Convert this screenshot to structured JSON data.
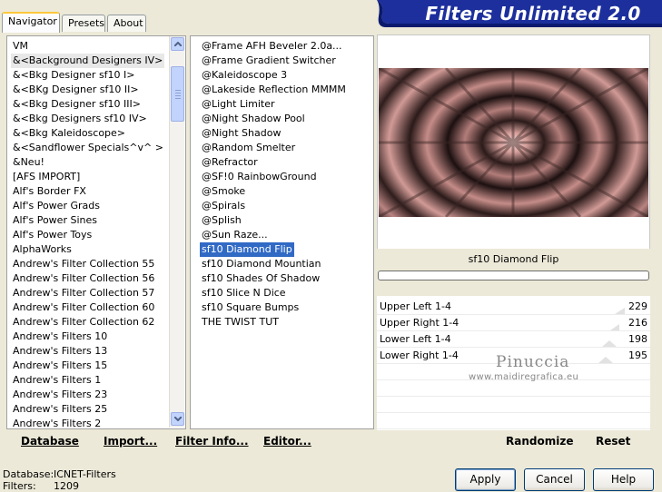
{
  "banner": {
    "title": "Filters Unlimited 2.0"
  },
  "tabs": [
    {
      "label": "Navigator"
    },
    {
      "label": "Presets"
    },
    {
      "label": "About"
    }
  ],
  "categories": [
    "VM",
    "&<Background Designers IV>",
    "&<Bkg Designer sf10 I>",
    "&<BKg Designer sf10 II>",
    "&<Bkg Designer sf10 III>",
    "&<Bkg Designers sf10 IV>",
    "&<Bkg Kaleidoscope>",
    "&<Sandflower Specials^v^ >",
    "&Neu!",
    "[AFS IMPORT]",
    "Alf's Border FX",
    "Alf's Power Grads",
    "Alf's Power Sines",
    "Alf's Power Toys",
    "AlphaWorks",
    "Andrew's Filter Collection 55",
    "Andrew's Filter Collection 56",
    "Andrew's Filter Collection 57",
    "Andrew's Filter Collection 60",
    "Andrew's Filter Collection 62",
    "Andrew's Filters 10",
    "Andrew's Filters 13",
    "Andrew's Filters 15",
    "Andrew's Filters 1",
    "Andrew's Filters 23",
    "Andrew's Filters 25",
    "Andrew's Filters 2"
  ],
  "filters": [
    "@Frame AFH Beveler 2.0a...",
    "@Frame Gradient Switcher",
    "@Kaleidoscope 3",
    "@Lakeside Reflection MMMM",
    "@Light Limiter",
    "@Night Shadow Pool",
    "@Night Shadow",
    "@Random Smelter",
    "@Refractor",
    "@SF!0 RainbowGround",
    "@Smoke",
    "@Spirals",
    "@Splish",
    "@Sun Raze...",
    "sf10 Diamond Flip",
    "sf10 Diamond Mountian",
    "sf10 Shades Of Shadow",
    "sf10 Slice N Dice",
    "sf10 Square Bumps",
    "THE TWIST TUT"
  ],
  "preview": {
    "filter_name": "sf10 Diamond Flip"
  },
  "sliders": [
    {
      "label": "Upper Left 1-4",
      "value": "229"
    },
    {
      "label": "Upper Right 1-4",
      "value": "216"
    },
    {
      "label": "Lower Left 1-4",
      "value": "198"
    },
    {
      "label": "Lower Right 1-4",
      "value": "195"
    }
  ],
  "watermark": {
    "name": "Pinuccia",
    "url": "www.maidiregrafica.eu"
  },
  "toolbar": {
    "database": "Database",
    "import": "Import...",
    "filter_info": "Filter Info...",
    "editor": "Editor...",
    "randomize": "Randomize",
    "reset": "Reset"
  },
  "status": {
    "database_label": "Database:",
    "database_value": "ICNET-Filters",
    "filters_label": "Filters:",
    "filters_value": "1209"
  },
  "buttons": {
    "apply": "Apply",
    "cancel": "Cancel",
    "help": "Help"
  },
  "colors": {
    "banner": "#1c2f9c",
    "selection": "#316ac5",
    "tab_highlight": "#ffc83c"
  }
}
